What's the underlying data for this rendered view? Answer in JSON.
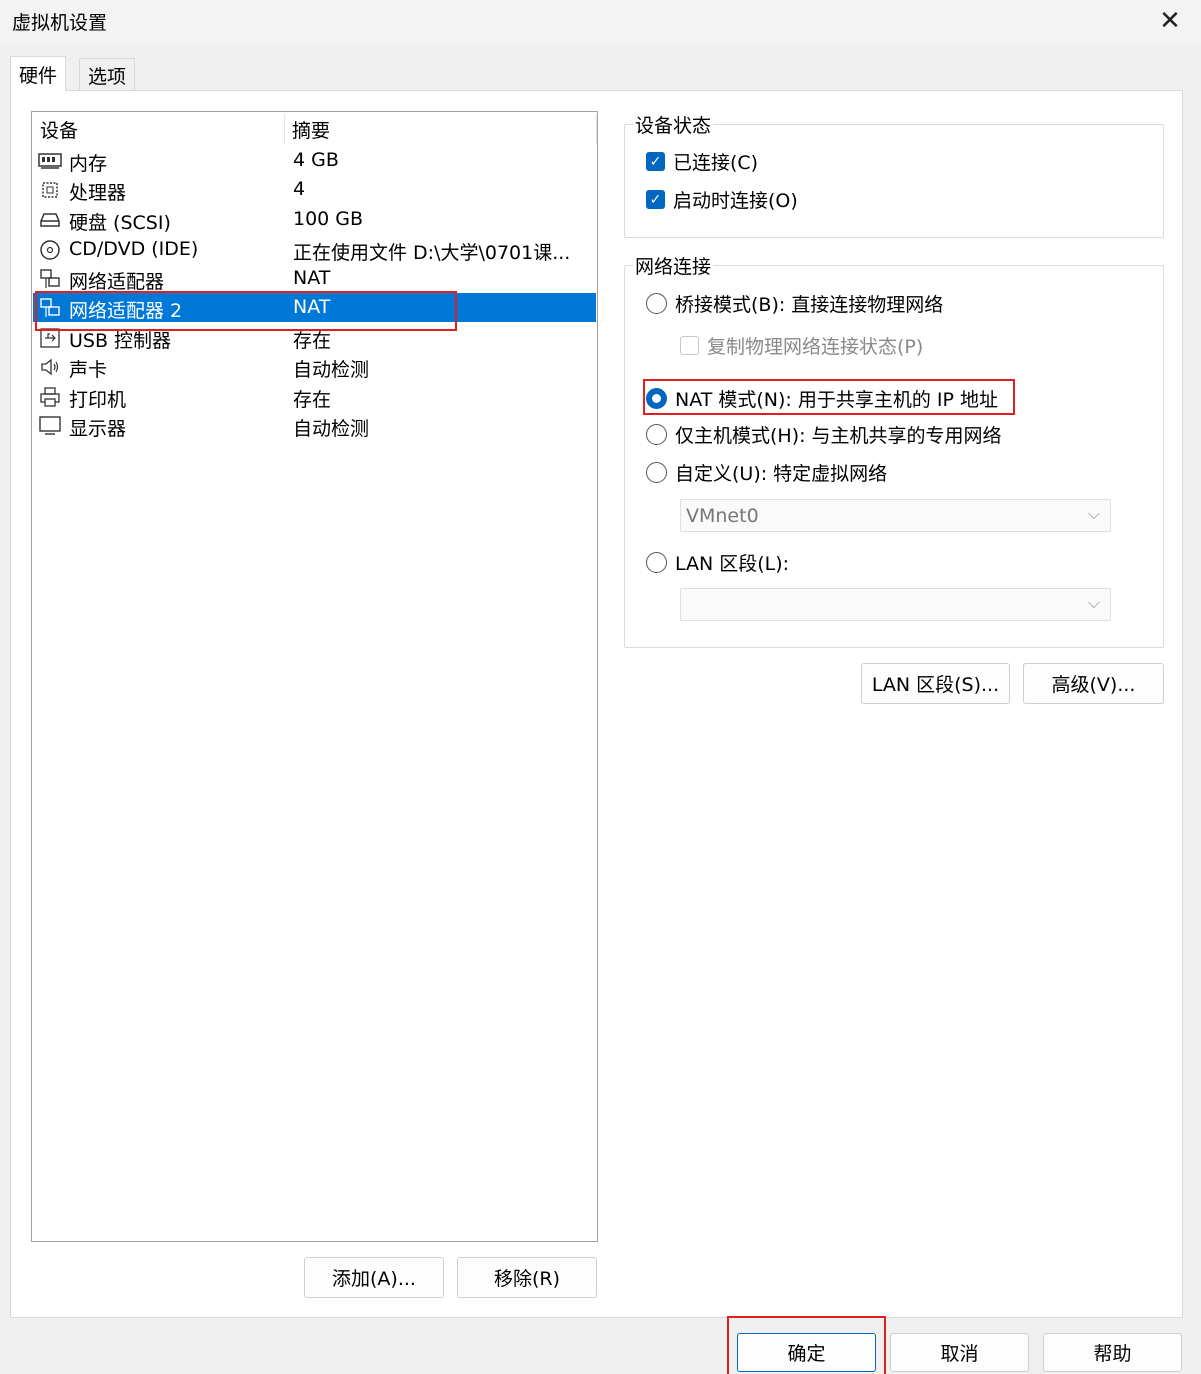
{
  "window": {
    "title": "虚拟机设置",
    "close_glyph": "✕"
  },
  "tabs": [
    {
      "label": "硬件",
      "active": true
    },
    {
      "label": "选项",
      "active": false
    }
  ],
  "device_list": {
    "headers": {
      "device": "设备",
      "summary": "摘要"
    },
    "rows": [
      {
        "icon": "memory-icon",
        "name": "内存",
        "summary": "4 GB",
        "selected": false
      },
      {
        "icon": "processor-icon",
        "name": "处理器",
        "summary": "4",
        "selected": false
      },
      {
        "icon": "harddisk-icon",
        "name": "硬盘 (SCSI)",
        "summary": "100 GB",
        "selected": false
      },
      {
        "icon": "cd-dvd-icon",
        "name": "CD/DVD (IDE)",
        "summary": "正在使用文件 D:\\大学\\0701课...",
        "selected": false
      },
      {
        "icon": "network-adapter-icon",
        "name": "网络适配器",
        "summary": "NAT",
        "selected": false
      },
      {
        "icon": "network-adapter-icon",
        "name": "网络适配器 2",
        "summary": "NAT",
        "selected": true
      },
      {
        "icon": "usb-controller-icon",
        "name": "USB 控制器",
        "summary": "存在",
        "selected": false
      },
      {
        "icon": "sound-card-icon",
        "name": "声卡",
        "summary": "自动检测",
        "selected": false
      },
      {
        "icon": "printer-icon",
        "name": "打印机",
        "summary": "存在",
        "selected": false
      },
      {
        "icon": "display-icon",
        "name": "显示器",
        "summary": "自动检测",
        "selected": false
      }
    ]
  },
  "list_buttons": {
    "add": "添加(A)...",
    "remove": "移除(R)"
  },
  "device_status": {
    "title": "设备状态",
    "connected": {
      "label": "已连接(C)",
      "checked": true
    },
    "connect_at_power_on": {
      "label": "启动时连接(O)",
      "checked": true
    }
  },
  "network_connection": {
    "title": "网络连接",
    "bridged": {
      "label": "桥接模式(B): 直接连接物理网络",
      "selected": false
    },
    "replicate_state": {
      "label": "复制物理网络连接状态(P)",
      "checked": false
    },
    "nat": {
      "label": "NAT 模式(N): 用于共享主机的 IP 地址",
      "selected": true
    },
    "host_only": {
      "label": "仅主机模式(H): 与主机共享的专用网络",
      "selected": false
    },
    "custom": {
      "label": "自定义(U): 特定虚拟网络",
      "selected": false
    },
    "custom_select_value": "VMnet0",
    "lan_segment": {
      "label": "LAN 区段(L):",
      "selected": false
    },
    "lan_select_value": ""
  },
  "network_buttons": {
    "lan_segments": "LAN 区段(S)...",
    "advanced": "高级(V)..."
  },
  "footer_buttons": {
    "ok": "确定",
    "cancel": "取消",
    "help": "帮助"
  },
  "colors": {
    "accent": "#0067c0",
    "selection": "#0078d7",
    "highlight_box": "#e02020"
  }
}
